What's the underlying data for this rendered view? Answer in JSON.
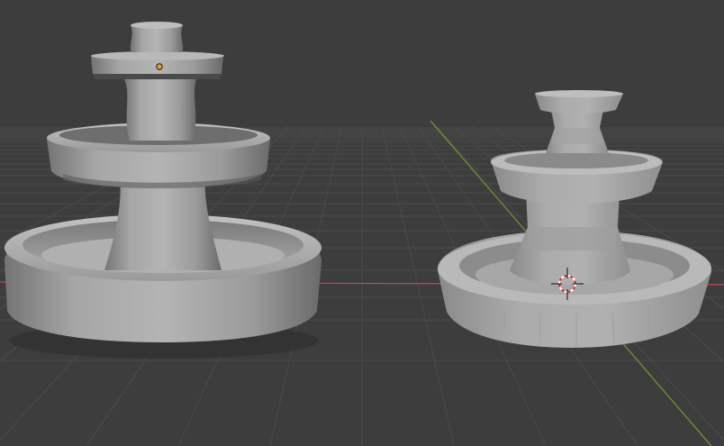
{
  "viewport": {
    "background": "#3d3d3d",
    "grid_color": "#4b4b4b",
    "x_axis_color": "#c04a55",
    "y_axis_color": "#6d8f2c"
  },
  "objects": [
    {
      "name": "smooth-fountain",
      "shading": "smooth",
      "selected": true,
      "origin_color": "#f29a2c"
    },
    {
      "name": "faceted-fountain",
      "shading": "flat",
      "selected": false
    }
  ],
  "cursor": {
    "icon": "3d-cursor-icon",
    "colors": [
      "#ffffff",
      "#d22a2a"
    ]
  }
}
